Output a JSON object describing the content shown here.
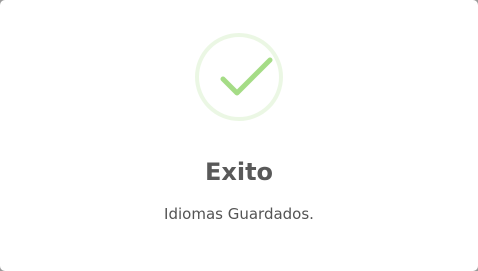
{
  "dialog": {
    "icon": "success-checkmark-icon",
    "title": "Exito",
    "message": "Idiomas Guardados."
  },
  "colors": {
    "success": "#a5dc86",
    "title": "#595959",
    "text": "#545454",
    "backdrop": "#9b9b9b"
  }
}
